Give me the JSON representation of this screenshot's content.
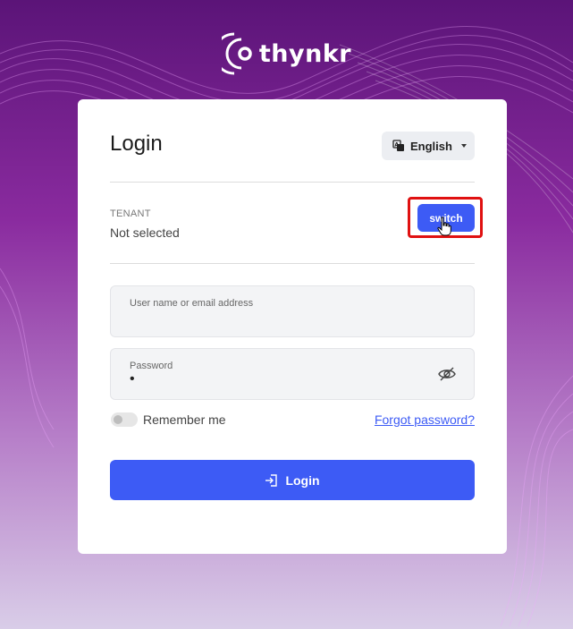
{
  "brand": {
    "name": "thynkr"
  },
  "login_card": {
    "title": "Login",
    "language": {
      "selected": "English",
      "icon": "translate-icon"
    },
    "tenant": {
      "label": "TENANT",
      "value": "Not selected",
      "switch_label": "switch"
    },
    "username": {
      "label": "User name or email address",
      "value": ""
    },
    "password": {
      "label": "Password",
      "value": "•",
      "toggle_icon": "eye-slash-icon"
    },
    "remember_me": {
      "label": "Remember me",
      "checked": false
    },
    "forgot_password": "Forgot password?",
    "submit": {
      "label": "Login",
      "icon": "login-icon"
    }
  },
  "colors": {
    "accent": "#3d5bf5",
    "highlight": "#e01111",
    "background_top": "#5b1478",
    "background_bottom": "#d9cde8"
  }
}
